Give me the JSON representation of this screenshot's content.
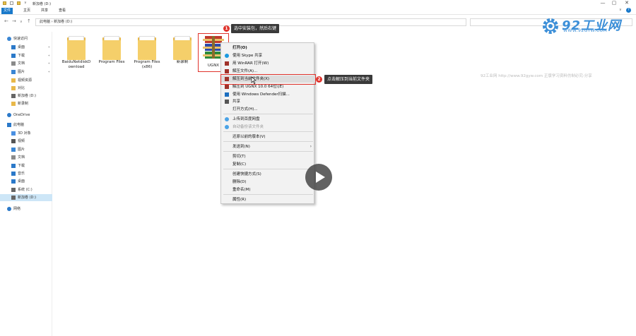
{
  "window": {
    "title": "新加卷 (D:)",
    "controls": [
      "—",
      "▢",
      "✕"
    ]
  },
  "ribbon": {
    "tabs": [
      "文件",
      "主页",
      "共享",
      "查看"
    ],
    "help": "?"
  },
  "address": {
    "path": "此电脑 › 新加卷 (D:)"
  },
  "nav": {
    "items": [
      {
        "label": "快速访问",
        "icon": "star-icon",
        "level": 0
      },
      {
        "label": "桌面",
        "icon": "desktop-icon",
        "level": 1,
        "pinned": true
      },
      {
        "label": "下载",
        "icon": "download-icon",
        "level": 1,
        "pinned": true
      },
      {
        "label": "文档",
        "icon": "document-icon",
        "level": 1,
        "pinned": true
      },
      {
        "label": "图片",
        "icon": "picture-icon",
        "level": 1,
        "pinned": true
      },
      {
        "label": "视频资源",
        "icon": "folder-icon",
        "level": 1
      },
      {
        "label": "对比",
        "icon": "folder-icon",
        "level": 1
      },
      {
        "label": "新加卷 (D:)",
        "icon": "drive-icon",
        "level": 1
      },
      {
        "label": "新录制",
        "icon": "folder-icon",
        "level": 1
      },
      {
        "label": "OneDrive",
        "icon": "cloud-icon",
        "level": 0
      },
      {
        "label": "此电脑",
        "icon": "pc-icon",
        "level": 0
      },
      {
        "label": "3D 对象",
        "icon": "cube-icon",
        "level": 1
      },
      {
        "label": "视频",
        "icon": "video-icon",
        "level": 1
      },
      {
        "label": "图片",
        "icon": "picture-icon",
        "level": 1
      },
      {
        "label": "文档",
        "icon": "document-icon",
        "level": 1
      },
      {
        "label": "下载",
        "icon": "download-icon",
        "level": 1
      },
      {
        "label": "音乐",
        "icon": "music-icon",
        "level": 1
      },
      {
        "label": "桌面",
        "icon": "desktop-icon",
        "level": 1
      },
      {
        "label": "系统 (C:)",
        "icon": "drive-icon",
        "level": 1
      },
      {
        "label": "新加卷 (D:)",
        "icon": "drive-icon",
        "level": 1,
        "selected": true
      },
      {
        "label": "网络",
        "icon": "network-icon",
        "level": 0
      }
    ]
  },
  "files": [
    {
      "name": "BaiduNetdiskDownload",
      "line1": "BaiduNetdiskD",
      "line2": "ownload"
    },
    {
      "name": "Program Files",
      "line1": "Program Files",
      "line2": ""
    },
    {
      "name": "Program Files (x86)",
      "line1": "Program Files",
      "line2": "(x86)"
    },
    {
      "name": "新录制",
      "line1": "新录制",
      "line2": ""
    },
    {
      "name": "UGNX",
      "line1": "UGNX",
      "line2": ""
    }
  ],
  "context_menu": {
    "items": [
      {
        "label": "打开(O)",
        "bold": true
      },
      {
        "label": "使用 Skype 共享",
        "icon": "skype-icon"
      },
      {
        "label": "用 WinRAR 打开(W)",
        "icon": "winrar-icon"
      },
      {
        "label": "解压文件(A)...",
        "icon": "winrar-icon"
      },
      {
        "label": "解压到当前文件夹(X)",
        "icon": "winrar-icon",
        "highlight": true
      },
      {
        "label": "解压到 UGNX 10.0 64位\\(E)",
        "icon": "winrar-icon"
      },
      {
        "label": "使用 Windows Defender扫描...",
        "icon": "defender-icon"
      },
      {
        "label": "共享",
        "icon": "share-icon"
      },
      {
        "label": "打开方式(H)..."
      },
      {
        "label": "上传到百度网盘",
        "icon": "baidu-icon"
      },
      {
        "label": "自动备份该文件夹",
        "icon": "baidu-icon",
        "dim": true
      },
      {
        "label": "还原以前的版本(V)"
      },
      {
        "label": "发送到(N)",
        "submenu": true
      },
      {
        "label": "剪切(T)"
      },
      {
        "label": "复制(C)"
      },
      {
        "label": "创建快捷方式(S)"
      },
      {
        "label": "删除(D)"
      },
      {
        "label": "重命名(M)"
      },
      {
        "label": "属性(R)"
      }
    ]
  },
  "annotations": {
    "step1": {
      "num": "1",
      "text": "选中安装包，然后右键"
    },
    "step2": {
      "num": "2",
      "text": "点击解压到当前文件夹"
    }
  },
  "watermark": {
    "logo_text": "92工业网",
    "logo_url": "WWW.92GYW.COM",
    "notice": "92工业网 http://www.92gyw.com 正版学习资料仿制必究-分享"
  },
  "colors": {
    "accent": "#1979ca",
    "annotation_red": "#e0332c",
    "folder_yellow": "#f5cf6a",
    "callout_bg": "#3a3a3a"
  }
}
